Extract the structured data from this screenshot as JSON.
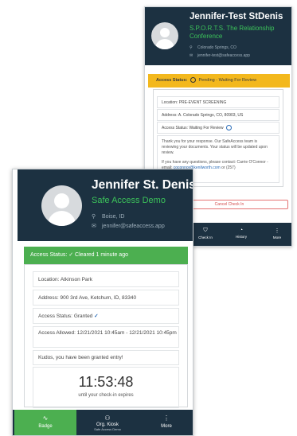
{
  "back": {
    "name": "Jennifer-Test StDenis",
    "org": "S.P.O.R.T.S. The Relationship Conference",
    "location": "Colorado Springs, CO",
    "email": "jennifer-test@safeaccess.app",
    "status_bar_label": "Access Status:",
    "status_bar_value": "Pending - Waiting For Review",
    "location_label": "Location:",
    "location_value": "PRE-EVENT SCREENING",
    "address_label": "Address:",
    "address_value": "A. Colorado Springs, CO, 80903, US",
    "access_status_label": "Access Status:",
    "access_status_value": "Waiting For Review",
    "message_1": "Thank you for your response.  Our SafeAccess team is reviewing your documents.  Your status will be updated upon review.",
    "message_2": "If you have any questions, please contact:  Carrie O'Connor - email:",
    "message_link": "coconnor@kenilworth.com",
    "message_tail": "or (257)",
    "cancel_label": "Cancel Check In",
    "nav": [
      {
        "label": "Check In",
        "icon": "shield-icon"
      },
      {
        "label": "History",
        "icon": "history-icon"
      },
      {
        "label": "More",
        "icon": "more-icon"
      }
    ]
  },
  "front": {
    "name": "Jennifer St. Denis",
    "org": "Safe Access Demo",
    "location": "Boise, ID",
    "email": "jennifer@safeaccess.app",
    "status_bar": "Access Status: ✓ Cleared 1 minute ago",
    "location_label": "Location:",
    "location_value": "Atkinson Park",
    "address_label": "Address:",
    "address_value": "900 3rd Ave, Ketchum, ID, 83340",
    "access_status_label": "Access Status:",
    "access_status_value": "Granted",
    "access_allowed_label": "Access Allowed:",
    "access_allowed_value": "12/21/2021 10:45am - 12/21/2021 10:45pm",
    "message": "Kudos, you have been granted entry!",
    "timer": "11:53:48",
    "timer_caption": "until your check-in expires",
    "nav": [
      {
        "label": "Badge",
        "icon": "badge-icon"
      },
      {
        "label": "Org. Kiosk",
        "sublabel": "Safe Access Demo",
        "icon": "people-icon"
      },
      {
        "label": "More",
        "icon": "more-icon"
      }
    ]
  },
  "colors": {
    "header": "#1c3141",
    "accent_green": "#4caf50",
    "org_green": "#3cc35a",
    "pending_yellow": "#f3b81d",
    "link_blue": "#2a6cb8",
    "cancel_red": "#d24b4b"
  }
}
